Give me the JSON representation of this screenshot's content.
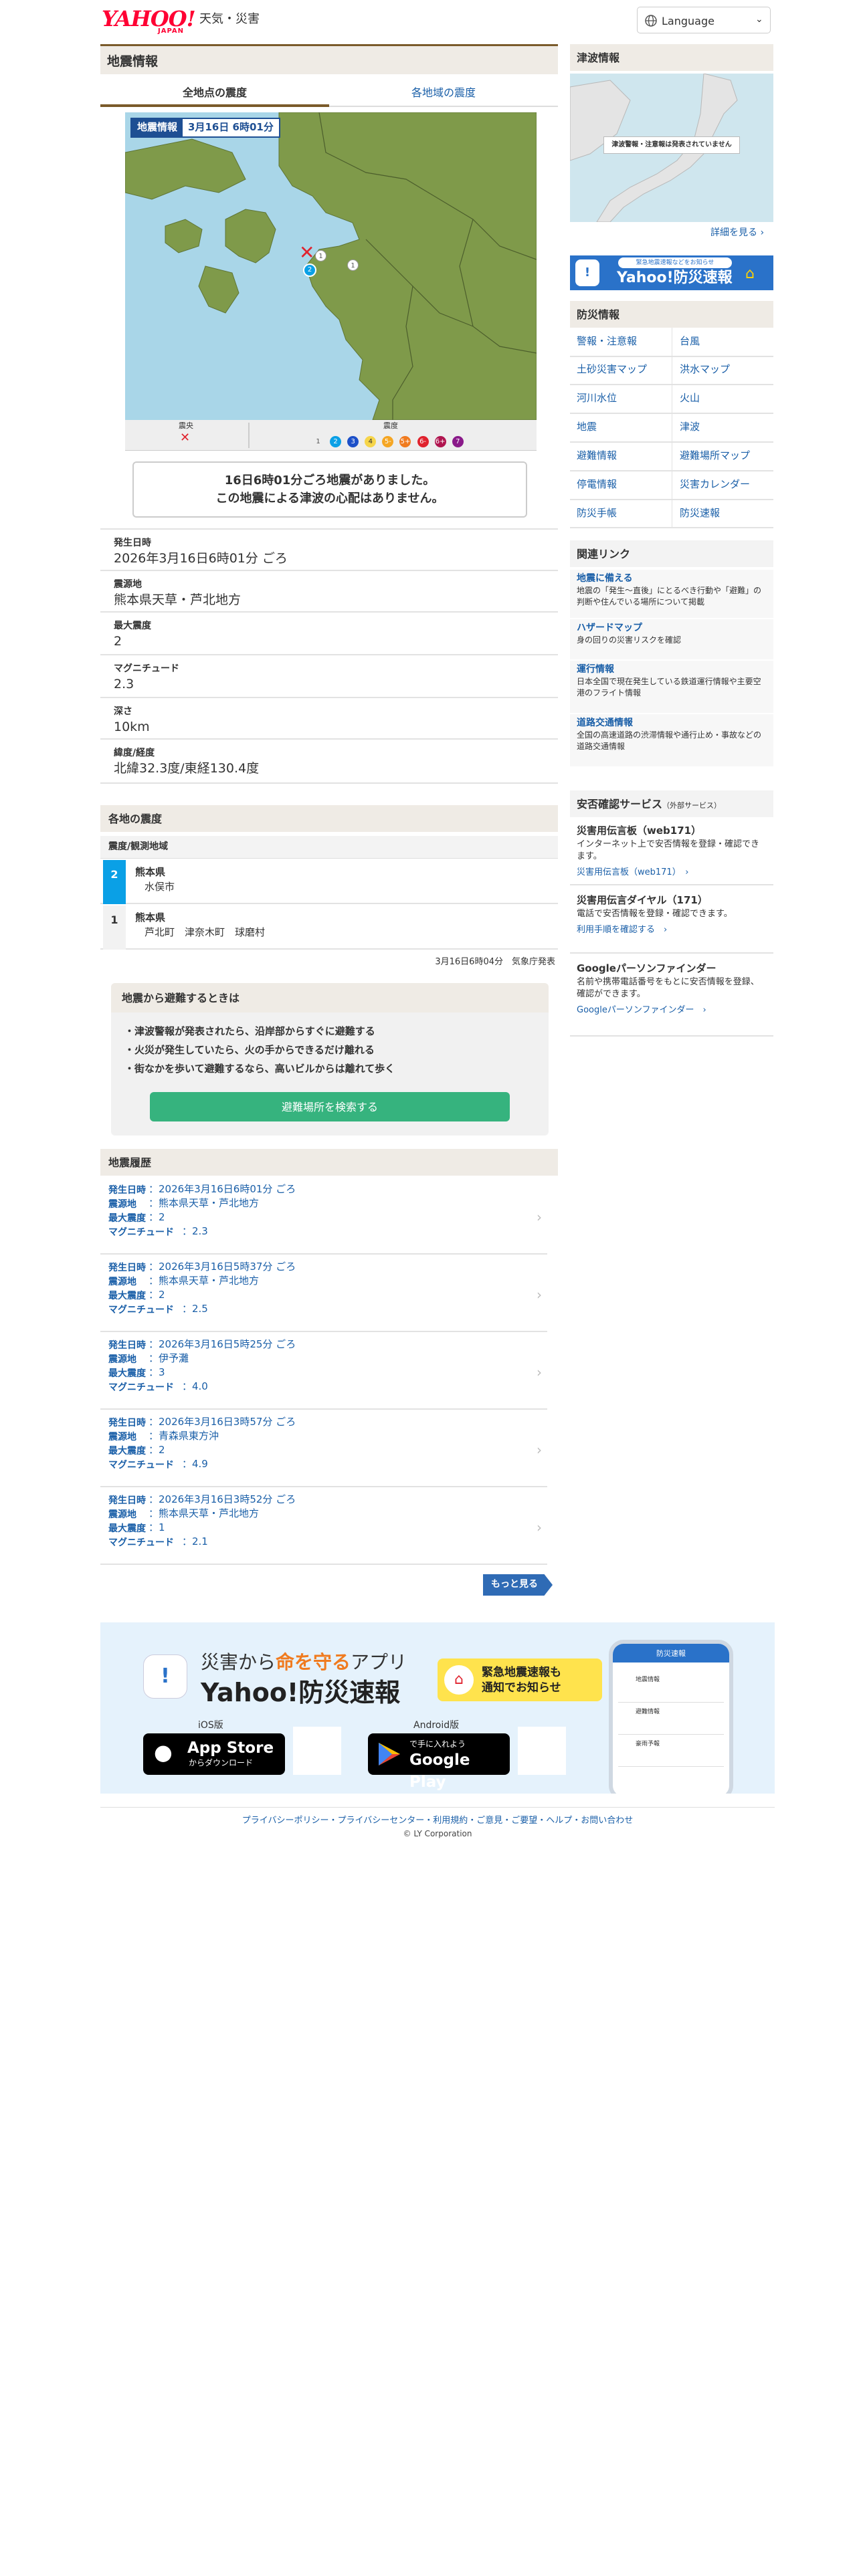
{
  "header": {
    "logo_main": "YAHOO!",
    "logo_sub": "JAPAN",
    "site_name": "天気・災害",
    "language_label": "Language"
  },
  "quake": {
    "section_title": "地震情報",
    "tabs": [
      "全地点の震度",
      "各地域の震度"
    ],
    "map": {
      "badge_label": "地震情報",
      "badge_date": "3月16日 6時01分",
      "legend_epicenter": "震央",
      "legend_intensity": "震度",
      "legend_levels": [
        "1",
        "2",
        "3",
        "4",
        "5-",
        "5+",
        "6-",
        "6+",
        "7"
      ]
    },
    "summary_line1": "16日6時01分ごろ地震がありました。",
    "summary_line2": "この地震による津波の心配はありません。",
    "details": [
      {
        "label": "発生日時",
        "value": "2026年3月16日6時01分 ごろ"
      },
      {
        "label": "震源地",
        "value": "熊本県天草・芦北地方"
      },
      {
        "label": "最大震度",
        "value": "2"
      },
      {
        "label": "マグニチュード",
        "value": "2.3"
      },
      {
        "label": "深さ",
        "value": "10km"
      },
      {
        "label": "緯度/経度",
        "value": "北緯32.3度/東経130.4度"
      }
    ],
    "regions_title": "各地の震度",
    "regions_subheader": "震度/観測地域",
    "regions": [
      {
        "intensity": "2",
        "pref": "熊本県",
        "places": "水俣市"
      },
      {
        "intensity": "1",
        "pref": "熊本県",
        "places": "芦北町　津奈木町　球磨村"
      }
    ],
    "published": "3月16日6時04分　気象庁発表"
  },
  "evac": {
    "title": "地震から避難するときは",
    "items": [
      "津波警報が発表されたら、沿岸部からすぐに避難する",
      "火災が発生していたら、火の手からできるだけ離れる",
      "街なかを歩いて避難するなら、高いビルからは離れて歩く"
    ],
    "button": "避難場所を検索する"
  },
  "history": {
    "title": "地震履歴",
    "labels": {
      "time": "発生日時",
      "place": "震源地",
      "max": "最大震度",
      "mag": "マグニチュード"
    },
    "rows": [
      {
        "time": "：2026年3月16日6時01分 ごろ",
        "place": "：熊本県天草・芦北地方",
        "max": "：2",
        "mag": "：2.3"
      },
      {
        "time": "：2026年3月16日5時37分 ごろ",
        "place": "：熊本県天草・芦北地方",
        "max": "：2",
        "mag": "：2.5"
      },
      {
        "time": "：2026年3月16日5時25分 ごろ",
        "place": "：伊予灘",
        "max": "：3",
        "mag": "：4.0"
      },
      {
        "time": "：2026年3月16日3時57分 ごろ",
        "place": "：青森県東方沖",
        "max": "：2",
        "mag": "：4.9"
      },
      {
        "time": "：2026年3月16日3時52分 ごろ",
        "place": "：熊本県天草・芦北地方",
        "max": "：1",
        "mag": "：2.1"
      }
    ],
    "more": "もっと見る"
  },
  "sidebar": {
    "tsunami_title": "津波情報",
    "tsunami_notice": "津波警報・注意報は発表されていません",
    "tsunami_more": "詳細を見る",
    "promo_top": "緊急地震速報などをお知らせ",
    "promo_name": "Yahoo!防災速報",
    "bousai_title": "防災情報",
    "bousai_links": [
      "警報・注意報",
      "台風",
      "土砂災害マップ",
      "洪水マップ",
      "河川水位",
      "火山",
      "地震",
      "津波",
      "避難情報",
      "避難場所マップ",
      "停電情報",
      "災害カレンダー",
      "防災手帳",
      "防災速報"
    ],
    "related_title": "関連リンク",
    "related": [
      {
        "title": "地震に備える",
        "desc": "地震の「発生〜直後」にとるべき行動や「避難」の判断や住んでいる場所について掲載"
      },
      {
        "title": "ハザードマップ",
        "desc": "身の回りの災害リスクを確認"
      },
      {
        "title": "運行情報",
        "desc": "日本全国で現在発生している鉄道運行情報や主要空港のフライト情報"
      },
      {
        "title": "道路交通情報",
        "desc": "全国の高速道路の渋滞情報や通行止め・事故などの道路交通情報"
      }
    ],
    "safety_title": "安否確認サービス",
    "safety_note": "（外部サービス）",
    "safety": [
      {
        "title": "災害用伝言板（web171）",
        "desc": "インターネット上で安否情報を登録・確認できます。",
        "link": "災害用伝言板（web171）"
      },
      {
        "title": "災害用伝言ダイヤル（171）",
        "desc": "電話で安否情報を登録・確認できます。",
        "link": "利用手順を確認する"
      },
      {
        "title": "Googleパーソンファインダー",
        "desc": "名前や携帯電話番号をもとに安否情報を登録、確認ができます。",
        "link": "Googleパーソンファインダー"
      }
    ]
  },
  "banner": {
    "tagline_pre": "災害から",
    "tagline_em": "命を守る",
    "tagline_post": "アプリ",
    "app_name": "Yahoo!防災速報",
    "bubble_l1": "緊急地震速報も",
    "bubble_l2": "通知でお知らせ",
    "ios_label": "iOS版",
    "android_label": "Android版",
    "appstore_small": "からダウンロード",
    "appstore_big": "App Store",
    "gplay_small": "で手に入れよう",
    "gplay_big": "Google Play",
    "phone_header": "防災速報",
    "phone_items": [
      "地震情報",
      "避難情報",
      "豪雨予報"
    ]
  },
  "footer": {
    "links": "プライバシーポリシー・プライバシーセンター・利用規約・ご意見・ご要望・ヘルプ・お問い合わせ",
    "copyright": "© LY Corporation"
  },
  "colors": {
    "accent": "#1a5fa8",
    "intensity2": "#0aa0e6",
    "evac_button": "#36b37e",
    "sea": "#a9d6e8",
    "land": "#7f9a4a",
    "more_button": "#2f6bb5"
  }
}
